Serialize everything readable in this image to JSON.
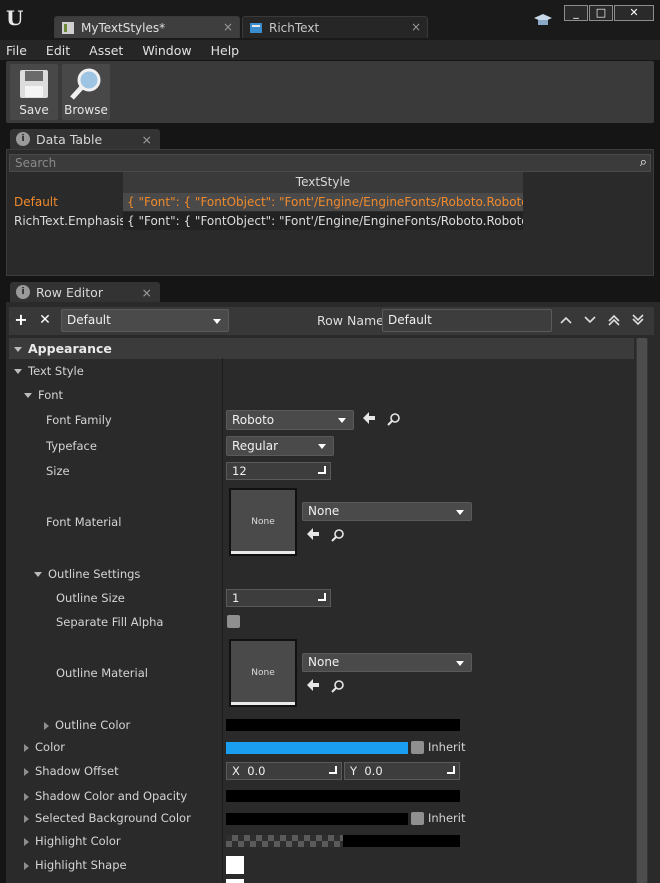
{
  "titlebar": {
    "tabs": [
      {
        "label": "MyTextStyles*",
        "close": "×",
        "icon": "datatable-icon"
      },
      {
        "label": "RichText",
        "close": "×",
        "icon": "widget-icon"
      }
    ],
    "window_buttons": [
      "_",
      "□",
      "✕"
    ]
  },
  "menu": [
    "File",
    "Edit",
    "Asset",
    "Window",
    "Help"
  ],
  "toolbar": {
    "save_label": "Save",
    "browse_label": "Browse"
  },
  "data_table": {
    "tab_label": "Data Table",
    "search_placeholder": "Search",
    "column_header": "TextStyle",
    "rows": [
      {
        "name": "Default",
        "value": "{ \"Font\": { \"FontObject\": \"Font'/Engine/EngineFonts/Roboto.Roboto'\", \"Fo",
        "selected": true
      },
      {
        "name": "RichText.Emphasis",
        "value": "{ \"Font\": { \"FontObject\": \"Font'/Engine/EngineFonts/Roboto.Roboto'\", \"Fo",
        "selected": false
      }
    ]
  },
  "row_editor": {
    "tab_label": "Row Editor",
    "add": "+",
    "remove": "✕",
    "row_select_value": "Default",
    "row_name_label": "Row Name:",
    "row_name_value": "Default",
    "nav": [
      "⌃",
      "⌄",
      "⇈",
      "⇊"
    ]
  },
  "details": {
    "category": "Appearance",
    "text_style": "Text Style",
    "font": "Font",
    "font_family": {
      "label": "Font Family",
      "value": "Roboto"
    },
    "typeface": {
      "label": "Typeface",
      "value": "Regular"
    },
    "size": {
      "label": "Size",
      "value": "12"
    },
    "font_material": {
      "label": "Font Material",
      "thumb": "None",
      "value": "None"
    },
    "outline_settings": "Outline Settings",
    "outline_size": {
      "label": "Outline Size",
      "value": "1"
    },
    "separate_fill_alpha": {
      "label": "Separate Fill Alpha"
    },
    "outline_material": {
      "label": "Outline Material",
      "thumb": "None",
      "value": "None"
    },
    "outline_color": {
      "label": "Outline Color",
      "color": "#000000"
    },
    "color": {
      "label": "Color",
      "color": "#1a9ef0",
      "inherit": "Inherit"
    },
    "shadow_offset": {
      "label": "Shadow Offset",
      "x_label": "X",
      "x_value": "0.0",
      "y_label": "Y",
      "y_value": "0.0"
    },
    "shadow_color": {
      "label": "Shadow Color and Opacity",
      "color": "#000000"
    },
    "selected_bg": {
      "label": "Selected Background Color",
      "color": "#000000",
      "inherit": "Inherit"
    },
    "highlight_color": {
      "label": "Highlight Color"
    },
    "highlight_shape": {
      "label": "Highlight Shape"
    }
  },
  "colors": {
    "selected_text": "#f08a2c",
    "selected_row_bg": "#4a4a4a",
    "accent_blue": "#1a9ef0"
  }
}
